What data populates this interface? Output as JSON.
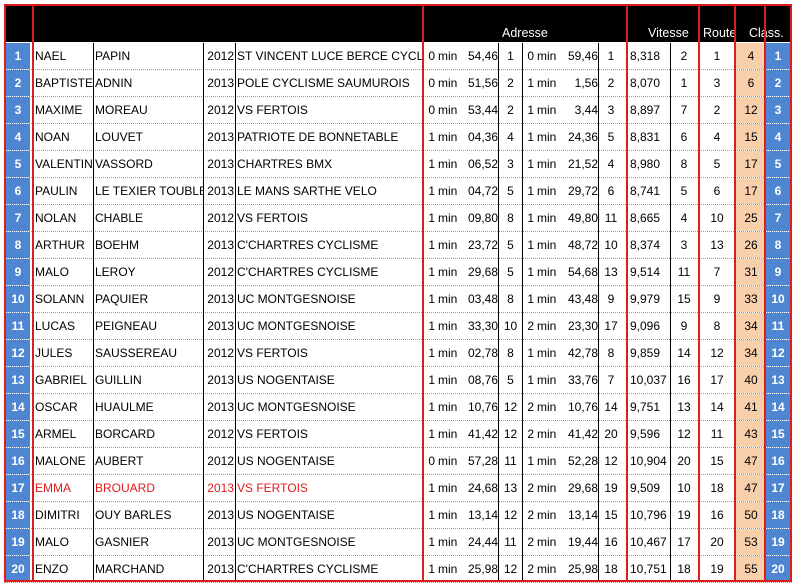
{
  "header": {
    "adresse": "Adresse",
    "vitesse": "Vitesse",
    "route": "Route",
    "classement": "Class."
  },
  "colors": {
    "header_bg": "#000000",
    "border": "#e01b1b",
    "rank_bg": "#4f86d2",
    "points_bg": "#f8cfab",
    "highlight_text": "#e01b1b"
  },
  "rows": [
    {
      "rank": "1",
      "first": "NAEL",
      "last": "PAPIN",
      "year": "2012",
      "club": "ST VINCENT LUCE BERCE CYCLISTE",
      "a1m": "0",
      "a1min": "min",
      "a1s": "54,46",
      "a1r": "1",
      "a2m": "0",
      "a2min": "min",
      "a2s": "59,46",
      "a2r": "1",
      "vit": "8,318",
      "vr": "2",
      "route": "1",
      "pts": "4",
      "highlight": false
    },
    {
      "rank": "2",
      "first": "BAPTISTE",
      "last": "ADNIN",
      "year": "2013",
      "club": "POLE CYCLISME SAUMUROIS",
      "a1m": "0",
      "a1min": "min",
      "a1s": "51,56",
      "a1r": "2",
      "a2m": "1",
      "a2min": "min",
      "a2s": "1,56",
      "a2r": "2",
      "vit": "8,070",
      "vr": "1",
      "route": "3",
      "pts": "6",
      "highlight": false
    },
    {
      "rank": "3",
      "first": "MAXIME",
      "last": "MOREAU",
      "year": "2012",
      "club": "VS FERTOIS",
      "a1m": "0",
      "a1min": "min",
      "a1s": "53,44",
      "a1r": "2",
      "a2m": "1",
      "a2min": "min",
      "a2s": "3,44",
      "a2r": "3",
      "vit": "8,897",
      "vr": "7",
      "route": "2",
      "pts": "12",
      "highlight": false
    },
    {
      "rank": "4",
      "first": "NOAN",
      "last": "LOUVET",
      "year": "2013",
      "club": "PATRIOTE DE BONNETABLE",
      "a1m": "1",
      "a1min": "min",
      "a1s": "04,36",
      "a1r": "4",
      "a2m": "1",
      "a2min": "min",
      "a2s": "24,36",
      "a2r": "5",
      "vit": "8,831",
      "vr": "6",
      "route": "4",
      "pts": "15",
      "highlight": false
    },
    {
      "rank": "5",
      "first": "VALENTIN",
      "last": "VASSORD",
      "year": "2013",
      "club": "CHARTRES BMX",
      "a1m": "1",
      "a1min": "min",
      "a1s": "06,52",
      "a1r": "3",
      "a2m": "1",
      "a2min": "min",
      "a2s": "21,52",
      "a2r": "4",
      "vit": "8,980",
      "vr": "8",
      "route": "5",
      "pts": "17",
      "highlight": false
    },
    {
      "rank": "6",
      "first": "PAULIN",
      "last": "LE TEXIER TOUBLET",
      "year": "2013",
      "club": "LE MANS SARTHE VELO",
      "a1m": "1",
      "a1min": "min",
      "a1s": "04,72",
      "a1r": "5",
      "a2m": "1",
      "a2min": "min",
      "a2s": "29,72",
      "a2r": "6",
      "vit": "8,741",
      "vr": "5",
      "route": "6",
      "pts": "17",
      "highlight": false
    },
    {
      "rank": "7",
      "first": "NOLAN",
      "last": "CHABLE",
      "year": "2012",
      "club": "VS FERTOIS",
      "a1m": "1",
      "a1min": "min",
      "a1s": "09,80",
      "a1r": "8",
      "a2m": "1",
      "a2min": "min",
      "a2s": "49,80",
      "a2r": "11",
      "vit": "8,665",
      "vr": "4",
      "route": "10",
      "pts": "25",
      "highlight": false
    },
    {
      "rank": "8",
      "first": "ARTHUR",
      "last": "BOEHM",
      "year": "2013",
      "club": "C'CHARTRES CYCLISME",
      "a1m": "1",
      "a1min": "min",
      "a1s": "23,72",
      "a1r": "5",
      "a2m": "1",
      "a2min": "min",
      "a2s": "48,72",
      "a2r": "10",
      "vit": "8,374",
      "vr": "3",
      "route": "13",
      "pts": "26",
      "highlight": false
    },
    {
      "rank": "9",
      "first": "MALO",
      "last": "LEROY",
      "year": "2012",
      "club": "C'CHARTRES CYCLISME",
      "a1m": "1",
      "a1min": "min",
      "a1s": "29,68",
      "a1r": "5",
      "a2m": "1",
      "a2min": "min",
      "a2s": "54,68",
      "a2r": "13",
      "vit": "9,514",
      "vr": "11",
      "route": "7",
      "pts": "31",
      "highlight": false
    },
    {
      "rank": "10",
      "first": "SOLANN",
      "last": "PAQUIER",
      "year": "2013",
      "club": "UC MONTGESNOISE",
      "a1m": "1",
      "a1min": "min",
      "a1s": "03,48",
      "a1r": "8",
      "a2m": "1",
      "a2min": "min",
      "a2s": "43,48",
      "a2r": "9",
      "vit": "9,979",
      "vr": "15",
      "route": "9",
      "pts": "33",
      "highlight": false
    },
    {
      "rank": "11",
      "first": "LUCAS",
      "last": "PEIGNEAU",
      "year": "2013",
      "club": "UC MONTGESNOISE",
      "a1m": "1",
      "a1min": "min",
      "a1s": "33,30",
      "a1r": "10",
      "a2m": "2",
      "a2min": "min",
      "a2s": "23,30",
      "a2r": "17",
      "vit": "9,096",
      "vr": "9",
      "route": "8",
      "pts": "34",
      "highlight": false
    },
    {
      "rank": "12",
      "first": "JULES",
      "last": "SAUSSEREAU",
      "year": "2012",
      "club": "VS FERTOIS",
      "a1m": "1",
      "a1min": "min",
      "a1s": "02,78",
      "a1r": "8",
      "a2m": "1",
      "a2min": "min",
      "a2s": "42,78",
      "a2r": "8",
      "vit": "9,859",
      "vr": "14",
      "route": "12",
      "pts": "34",
      "highlight": false
    },
    {
      "rank": "13",
      "first": "GABRIEL",
      "last": "GUILLIN",
      "year": "2013",
      "club": "US NOGENTAISE",
      "a1m": "1",
      "a1min": "min",
      "a1s": "08,76",
      "a1r": "5",
      "a2m": "1",
      "a2min": "min",
      "a2s": "33,76",
      "a2r": "7",
      "vit": "10,037",
      "vr": "16",
      "route": "17",
      "pts": "40",
      "highlight": false
    },
    {
      "rank": "14",
      "first": "OSCAR",
      "last": "HUAULME",
      "year": "2013",
      "club": "UC MONTGESNOISE",
      "a1m": "1",
      "a1min": "min",
      "a1s": "10,76",
      "a1r": "12",
      "a2m": "2",
      "a2min": "min",
      "a2s": "10,76",
      "a2r": "14",
      "vit": "9,751",
      "vr": "13",
      "route": "14",
      "pts": "41",
      "highlight": false
    },
    {
      "rank": "15",
      "first": "ARMEL",
      "last": "BORCARD",
      "year": "2012",
      "club": "VS FERTOIS",
      "a1m": "1",
      "a1min": "min",
      "a1s": "41,42",
      "a1r": "12",
      "a2m": "2",
      "a2min": "min",
      "a2s": "41,42",
      "a2r": "20",
      "vit": "9,596",
      "vr": "12",
      "route": "11",
      "pts": "43",
      "highlight": false
    },
    {
      "rank": "16",
      "first": "MALONE",
      "last": "AUBERT",
      "year": "2012",
      "club": "US NOGENTAISE",
      "a1m": "0",
      "a1min": "min",
      "a1s": "57,28",
      "a1r": "11",
      "a2m": "1",
      "a2min": "min",
      "a2s": "52,28",
      "a2r": "12",
      "vit": "10,904",
      "vr": "20",
      "route": "15",
      "pts": "47",
      "highlight": false
    },
    {
      "rank": "17",
      "first": "EMMA",
      "last": "BROUARD",
      "year": "2013",
      "club": "VS FERTOIS",
      "a1m": "1",
      "a1min": "min",
      "a1s": "24,68",
      "a1r": "13",
      "a2m": "2",
      "a2min": "min",
      "a2s": "29,68",
      "a2r": "19",
      "vit": "9,509",
      "vr": "10",
      "route": "18",
      "pts": "47",
      "highlight": true
    },
    {
      "rank": "18",
      "first": "DIMITRI",
      "last": "OUY BARLES",
      "year": "2013",
      "club": "US NOGENTAISE",
      "a1m": "1",
      "a1min": "min",
      "a1s": "13,14",
      "a1r": "12",
      "a2m": "2",
      "a2min": "min",
      "a2s": "13,14",
      "a2r": "15",
      "vit": "10,796",
      "vr": "19",
      "route": "16",
      "pts": "50",
      "highlight": false
    },
    {
      "rank": "19",
      "first": "MALO",
      "last": "GASNIER",
      "year": "2013",
      "club": "UC MONTGESNOISE",
      "a1m": "1",
      "a1min": "min",
      "a1s": "24,44",
      "a1r": "11",
      "a2m": "2",
      "a2min": "min",
      "a2s": "19,44",
      "a2r": "16",
      "vit": "10,467",
      "vr": "17",
      "route": "20",
      "pts": "53",
      "highlight": false
    },
    {
      "rank": "20",
      "first": "ENZO",
      "last": "MARCHAND",
      "year": "2013",
      "club": "C'CHARTRES CYCLISME",
      "a1m": "1",
      "a1min": "min",
      "a1s": "25,98",
      "a1r": "12",
      "a2m": "2",
      "a2min": "min",
      "a2s": "25,98",
      "a2r": "18",
      "vit": "10,751",
      "vr": "18",
      "route": "19",
      "pts": "55",
      "highlight": false
    }
  ]
}
